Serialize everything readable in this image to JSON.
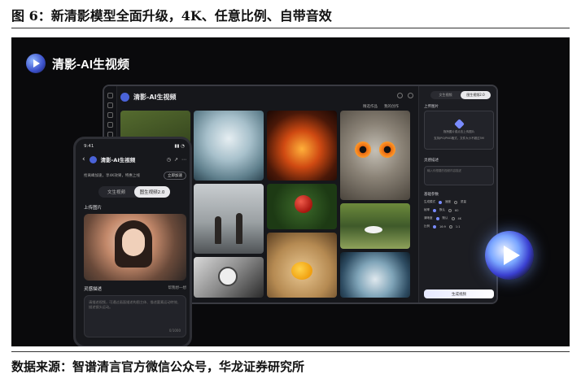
{
  "figure": {
    "title": "图 6：新清影模型全面升级，4K、任意比例、自带音效",
    "source": "数据来源：智谱清言官方微信公众号，华龙证券研究所"
  },
  "brand": {
    "name": "清影-AI生视频"
  },
  "desktop": {
    "title": "清影-AI生视频",
    "tabs": [
      "精选作品",
      "我的创作"
    ],
    "panel": {
      "mode_tabs": [
        "文生视频",
        "图生视频2.0"
      ],
      "upload_label": "上传图片",
      "upload_hint": "拖拽图片或点击上传图片",
      "upload_sub": "支持JPG/PNG格式，文件大小不超过5M",
      "prompt_label": "灵感描述",
      "prompt_placeholder": "输入你想要的视频内容描述",
      "params_label": "基础参数",
      "options": [
        {
          "name": "生成模式",
          "choices": [
            "速度",
            "质量"
          ]
        },
        {
          "name": "帧率",
          "choices": [
            "默认",
            "60"
          ]
        },
        {
          "name": "清晰度",
          "choices": [
            "默认",
            "4K"
          ]
        },
        {
          "name": "比例",
          "choices": [
            "16:9",
            "1:1"
          ]
        }
      ],
      "generate": "生成视频"
    }
  },
  "phone": {
    "time": "9:41",
    "status": "▮▮ ◔",
    "title": "清影-AI生视频",
    "subtitle": "抢离峰加速，享4K效果，特惠上线",
    "chip": "立即加速",
    "mode_tabs": [
      "文生视频",
      "图生视频2.0"
    ],
    "upload_label": "上传图片",
    "prompt_label": "灵感描述",
    "prompt_hint": "帮我想一想",
    "prompt_placeholder": "请描述视频，可通过画面描述构图主体、描述要素运动特效、描述镜头运动。",
    "counter": "0/1000"
  }
}
